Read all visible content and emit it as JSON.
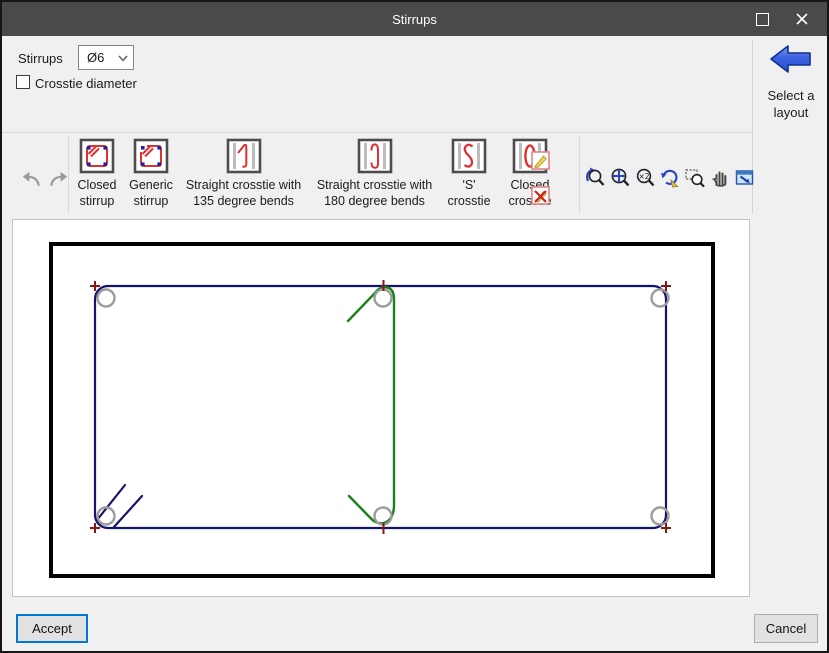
{
  "window": {
    "title": "Stirrups",
    "icons": {
      "maximize": "square-outline",
      "close": "x-mark"
    }
  },
  "controls": {
    "stirrups_label": "Stirrups",
    "diameter_value": "Ø6",
    "crosstie_checkbox_label": "Crosstie diameter",
    "crosstie_checked": false
  },
  "layout_panel": {
    "label": "Select a layout",
    "arrow_icon": "blue-left-arrow"
  },
  "toolbar": {
    "undo_icon": "undo-arrow",
    "redo_icon": "redo-arrow",
    "tools": [
      {
        "id": "closed-stirrup",
        "label": "Closed stirrup"
      },
      {
        "id": "generic-stirrup",
        "label": "Generic stirrup"
      },
      {
        "id": "crosstie-135",
        "label": "Straight crosstie with 135 degree bends"
      },
      {
        "id": "crosstie-180",
        "label": "Straight crosstie with 180 degree bends"
      },
      {
        "id": "s-crosstie",
        "label": "'S' crosstie"
      },
      {
        "id": "closed-crosstie",
        "label": "Closed crosstie"
      }
    ],
    "edit_icons": [
      "edit-element",
      "delete-element"
    ],
    "zoom_tools": [
      "zoom-previous",
      "zoom-extents",
      "zoom-x2",
      "redraw",
      "zoom-window",
      "pan-hand",
      "send-to-window"
    ]
  },
  "canvas": {
    "colors": {
      "section_outline": "#000000",
      "stirrup": "#14146e",
      "crosstie": "#1a801a",
      "rebar": "#9c9c9c",
      "marker": "#8b1515"
    }
  },
  "buttons": {
    "accept": "Accept",
    "cancel": "Cancel"
  }
}
